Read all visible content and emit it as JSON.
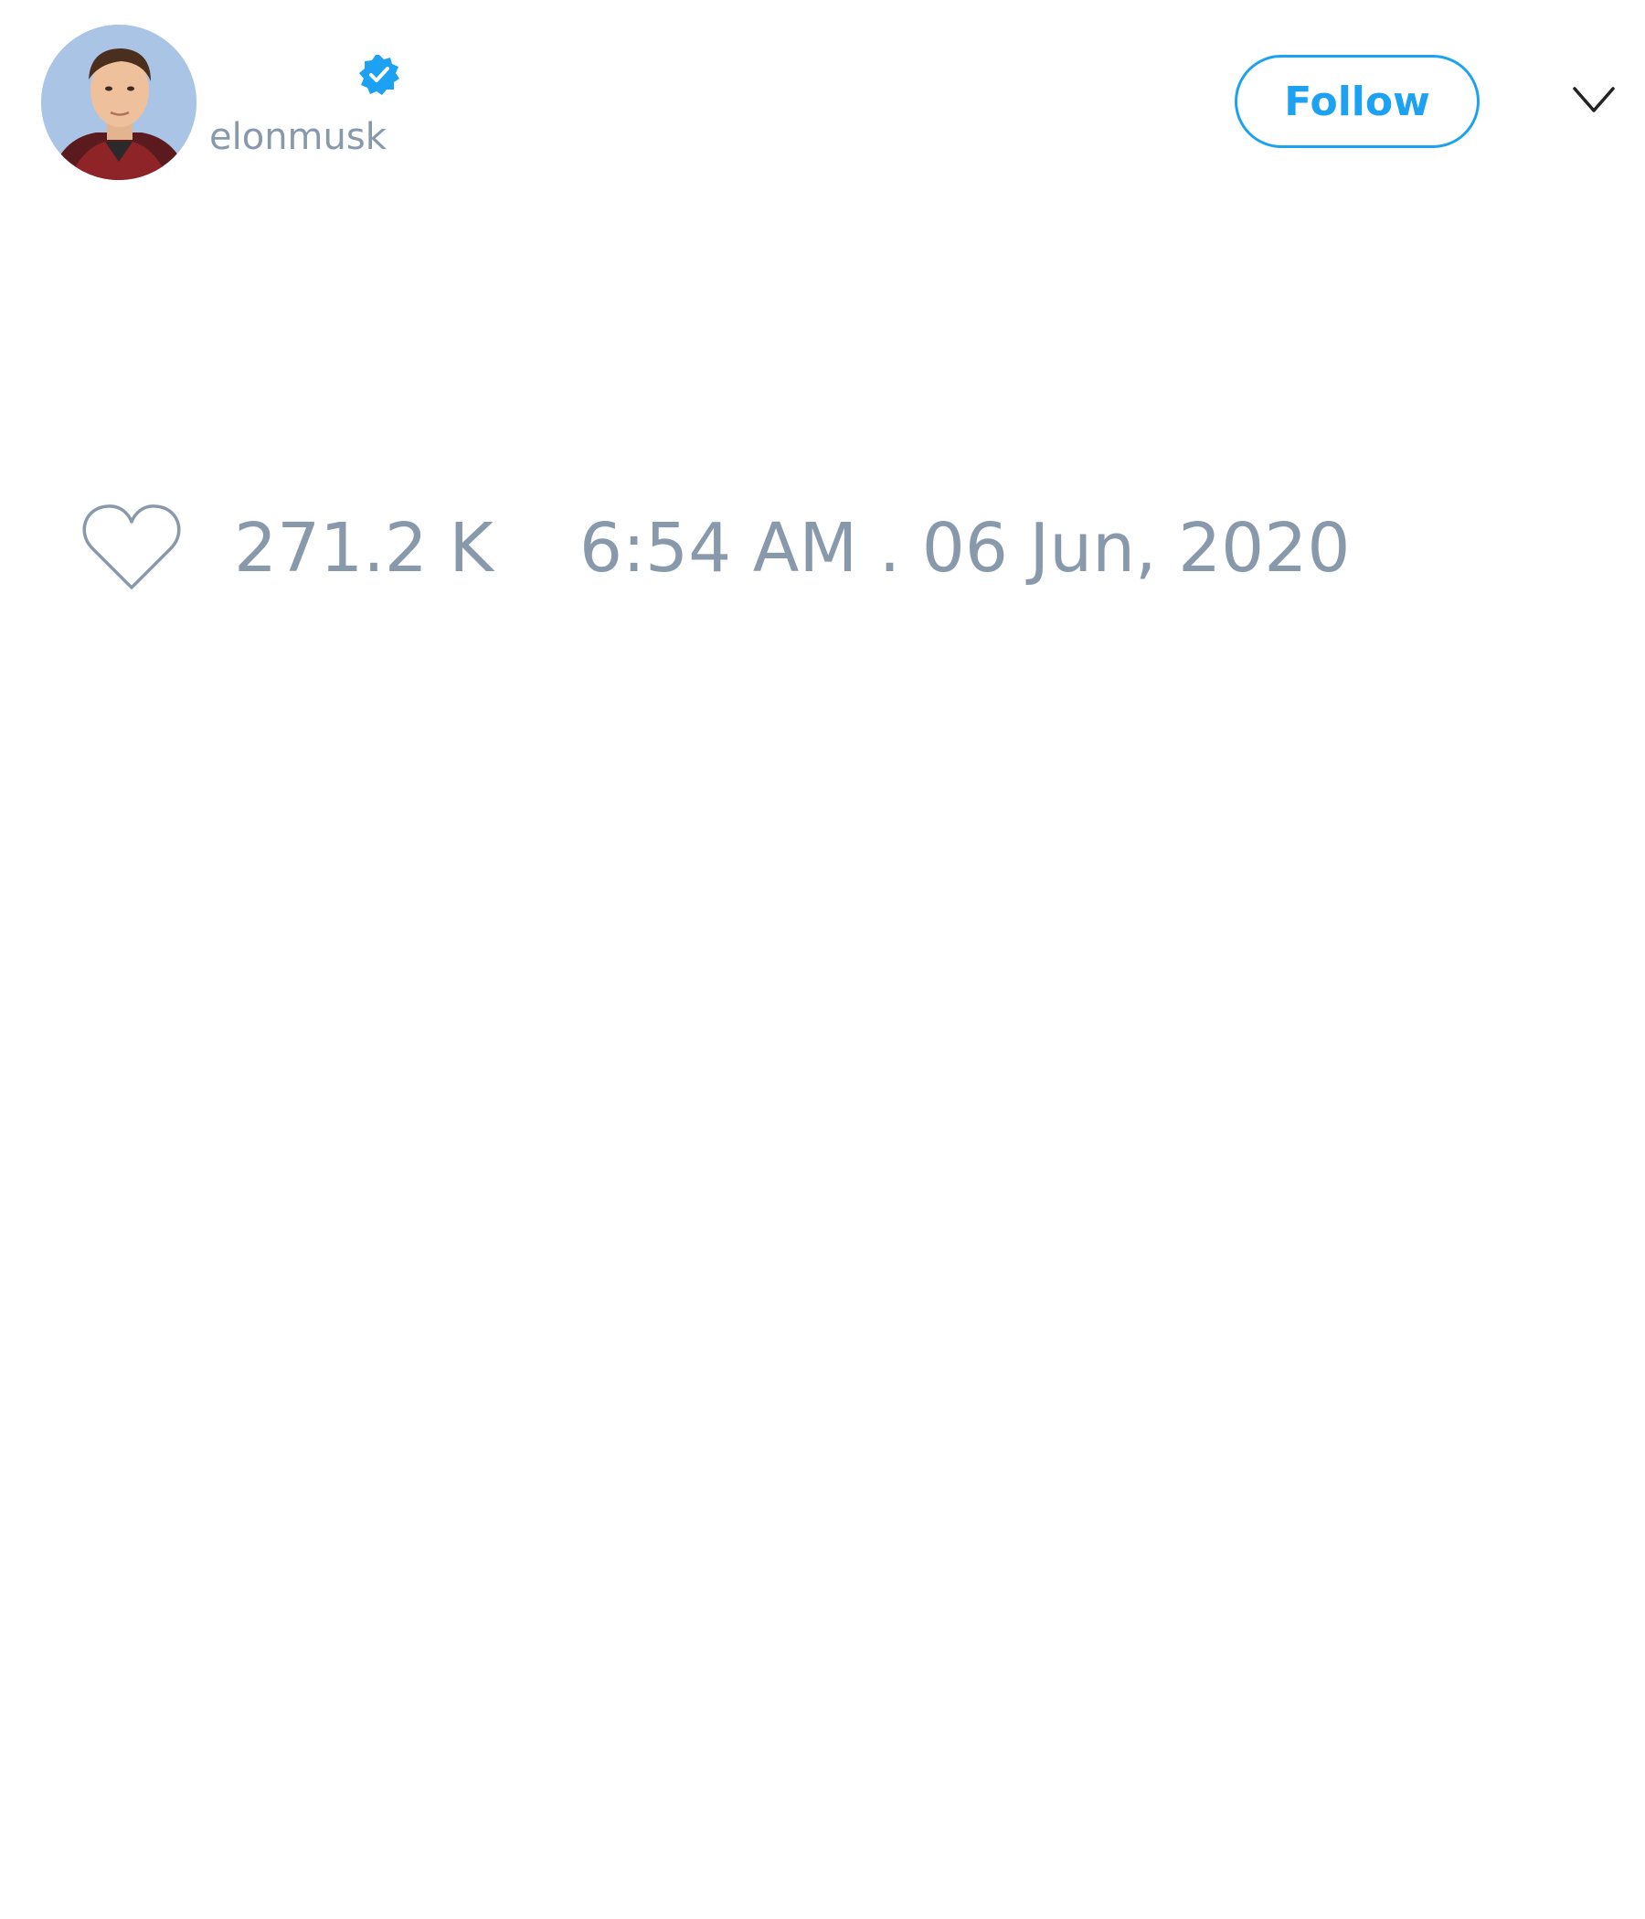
{
  "tweet": {
    "author": {
      "username": "elonmusk",
      "verified": true,
      "avatar_icon": "profile-photo"
    },
    "follow_label": "Follow",
    "menu_icon": "chevron-down-icon",
    "like_icon": "heart-outline-icon",
    "likes": "271.2 K",
    "timestamp": "6:54 AM . 06 Jun, 2020"
  },
  "colors": {
    "accent": "#1da1f2",
    "muted_text": "#8899ac",
    "background": "#ffffff"
  }
}
